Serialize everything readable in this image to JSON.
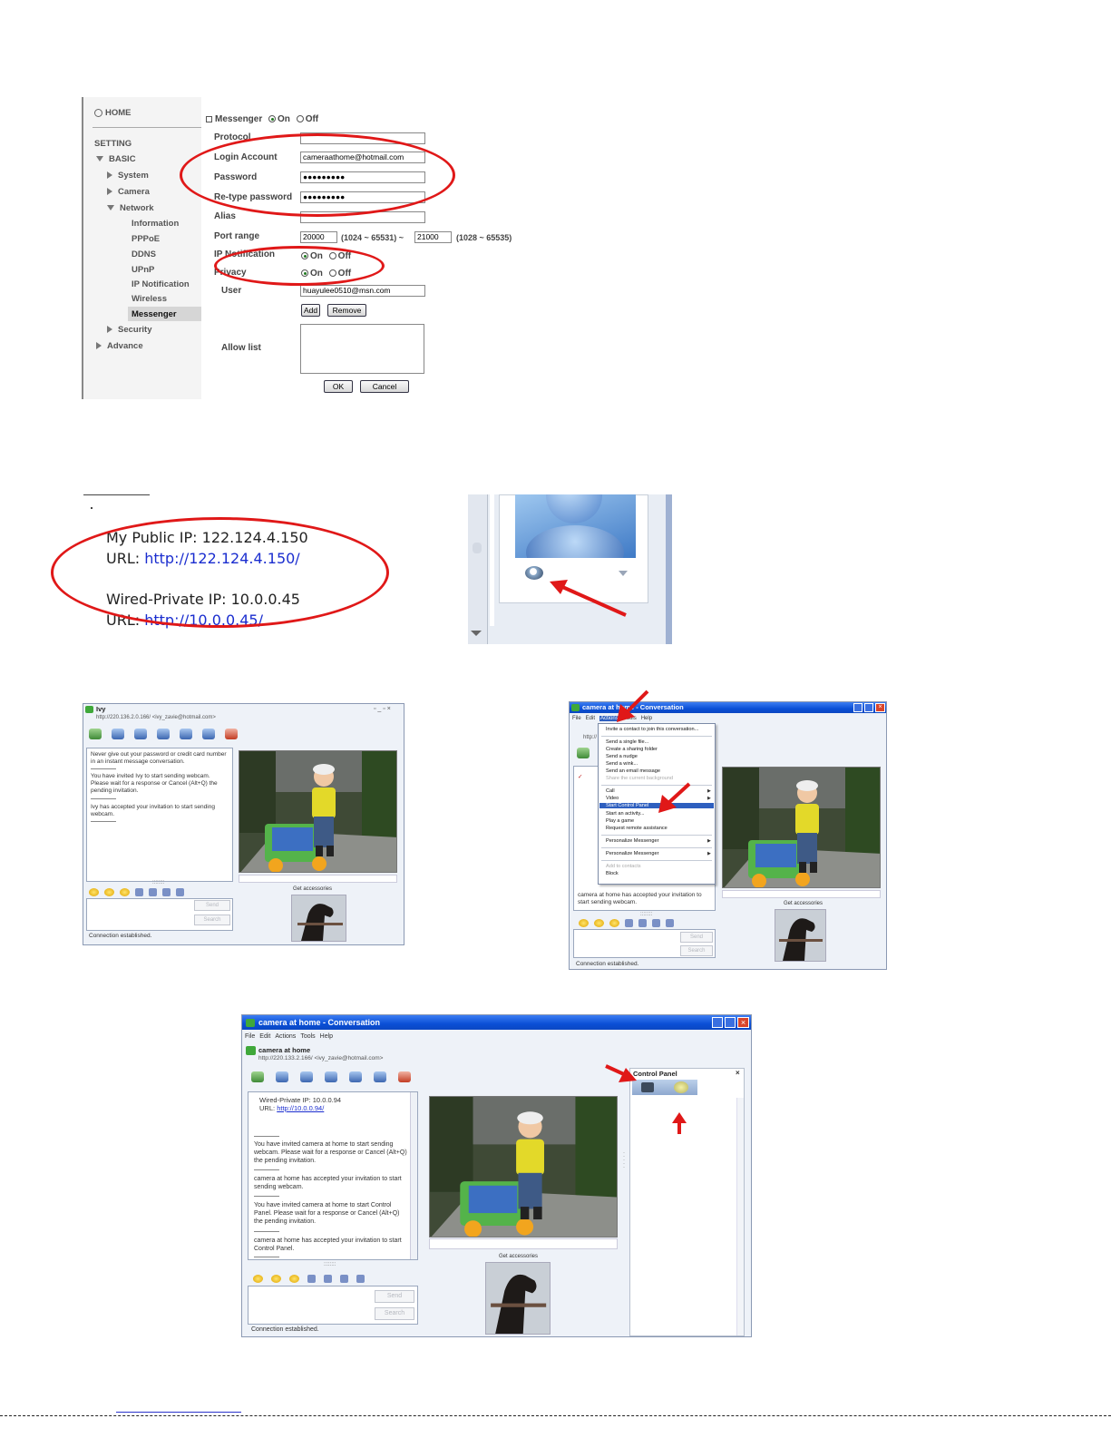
{
  "web_ui": {
    "sidebar": {
      "home": "HOME",
      "setting": "SETTING",
      "basic": "BASIC",
      "system": "System",
      "camera": "Camera",
      "network": "Network",
      "information": "Information",
      "pppoe": "PPPoE",
      "ddns": "DDNS",
      "upnp": "UPnP",
      "ip_notification": "IP Notification",
      "wireless": "Wireless",
      "messenger": "Messenger",
      "security": "Security",
      "advance": "Advance"
    },
    "form": {
      "messenger_label": "Messenger",
      "on": "On",
      "off": "Off",
      "protocol": "Protocol",
      "login_account": "Login Account",
      "login_account_value": "cameraathome@hotmail.com",
      "password": "Password",
      "password_value": "●●●●●●●●●",
      "retype_password": "Re-type password",
      "retype_password_value": "●●●●●●●●●",
      "alias": "Alias",
      "port_range": "Port range",
      "port_from": "20000",
      "port_from_range": "(1024 ~ 65531) ~",
      "port_to": "21000",
      "port_to_range": "(1028 ~ 65535)",
      "ip_notification": "IP Notification",
      "privacy": "Privacy",
      "user": "User",
      "user_value": "huayulee0510@msn.com",
      "add": "Add",
      "remove": "Remove",
      "allow_list": "Allow list",
      "ok": "OK",
      "cancel": "Cancel"
    }
  },
  "ip_info": {
    "public_label": "My Public IP: 122.124.4.150",
    "url_label": "URL:",
    "public_url": "http://122.124.4.150/",
    "private_label": "Wired-Private IP: 10.0.0.45",
    "private_url": "http://10.0.0.45/"
  },
  "chat_ivy": {
    "title": "Ivy",
    "address": "http://220.136.2.0.166/ <ivy_zavie@hotmail.com>",
    "messages": [
      "Never give out your password or credit card number in an instant message conversation.",
      "You have invited Ivy to start sending webcam. Please wait for a response or Cancel (Alt+Q) the pending invitation.",
      "Ivy has accepted your invitation to start sending webcam."
    ],
    "send": "Send",
    "search": "Search",
    "status": "Connection established.",
    "get_accessories": "Get accessories"
  },
  "chat_actions": {
    "title": "camera at home - Conversation",
    "menus": [
      "File",
      "Edit",
      "Actions",
      "Tools",
      "Help"
    ],
    "address_short": "http://",
    "menu_items": [
      "Invite a contact to join this conversation...",
      "Send a single file...",
      "Create a sharing folder",
      "Send a nudge",
      "Send a wink...",
      "Send an email message",
      "Share the current background",
      "Call",
      "Video",
      "Start Control Panel",
      "Start an activity...",
      "Play a game",
      "Request remote assistance",
      "Personalize Messenger",
      "Personalize Messenger",
      "Add to contacts",
      "Block"
    ],
    "last_message": "camera at home has accepted your invitation to start sending webcam.",
    "send": "Send",
    "search": "Search",
    "status": "Connection established.",
    "get_accessories": "Get accessories"
  },
  "chat_control": {
    "title": "camera at home - Conversation",
    "menus": [
      "File",
      "Edit",
      "Actions",
      "Tools",
      "Help"
    ],
    "contact": "camera at home",
    "address": "http://220.133.2.166/ <ivy_zavie@hotmail.com>",
    "private_ip": "Wired-Private IP: 10.0.0.94",
    "url_label": "URL:",
    "url": "http://10.0.0.94/",
    "messages": [
      "You have invited camera at home to start sending webcam. Please wait for a response or Cancel (Alt+Q) the pending invitation.",
      "camera at home has accepted your invitation to start sending webcam.",
      "You have invited camera at home to start Control Panel. Please wait for a response or Cancel (Alt+Q) the pending invitation.",
      "camera at home has accepted your invitation to start Control Panel."
    ],
    "control_panel": "Control Panel",
    "close": "×",
    "send": "Send",
    "search": "Search",
    "status": "Connection established.",
    "get_accessories": "Get accessories"
  }
}
